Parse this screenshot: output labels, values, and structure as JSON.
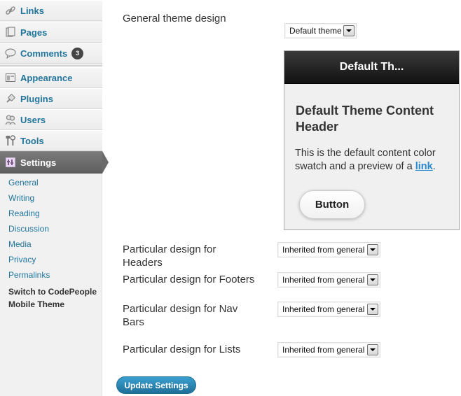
{
  "sidebar": {
    "links_label": "Links",
    "pages_label": "Pages",
    "comments_label": "Comments",
    "comments_count": "3",
    "appearance_label": "Appearance",
    "plugins_label": "Plugins",
    "users_label": "Users",
    "tools_label": "Tools",
    "settings_label": "Settings",
    "submenu": {
      "general": "General",
      "writing": "Writing",
      "reading": "Reading",
      "discussion": "Discussion",
      "media": "Media",
      "privacy": "Privacy",
      "permalinks": "Permalinks",
      "current": "Switch to CodePeople Mobile Theme"
    },
    "icons": [
      "link-icon",
      "pages-icon",
      "comments-icon",
      "appearance-icon",
      "plugins-icon",
      "users-icon",
      "tools-icon",
      "settings-icon"
    ]
  },
  "main": {
    "general_theme_label": "General theme design",
    "general_theme_select": "Default theme",
    "preview": {
      "header": "Default Th...",
      "content_header": "Default Theme Content Header",
      "text_before_link": "This is the default content color swatch and a preview of a ",
      "link_text": "link",
      "text_after_link": ".",
      "button_label": "Button"
    },
    "rows": {
      "headers": {
        "label": "Particular design for Headers",
        "value": "Inherited from general"
      },
      "footers": {
        "label": "Particular design for Footers",
        "value": "Inherited from general"
      },
      "navbars": {
        "label": "Particular design for Nav Bars",
        "value": "Inherited from general"
      },
      "lists": {
        "label": "Particular design for Lists",
        "value": "Inherited from general"
      }
    },
    "update_button": "Update Settings"
  },
  "colors": {
    "link": "#21759b",
    "primary_button": "#2a87b8",
    "preview_header": "#1e1e1e",
    "sidebar_current": "#6a6a6a"
  }
}
